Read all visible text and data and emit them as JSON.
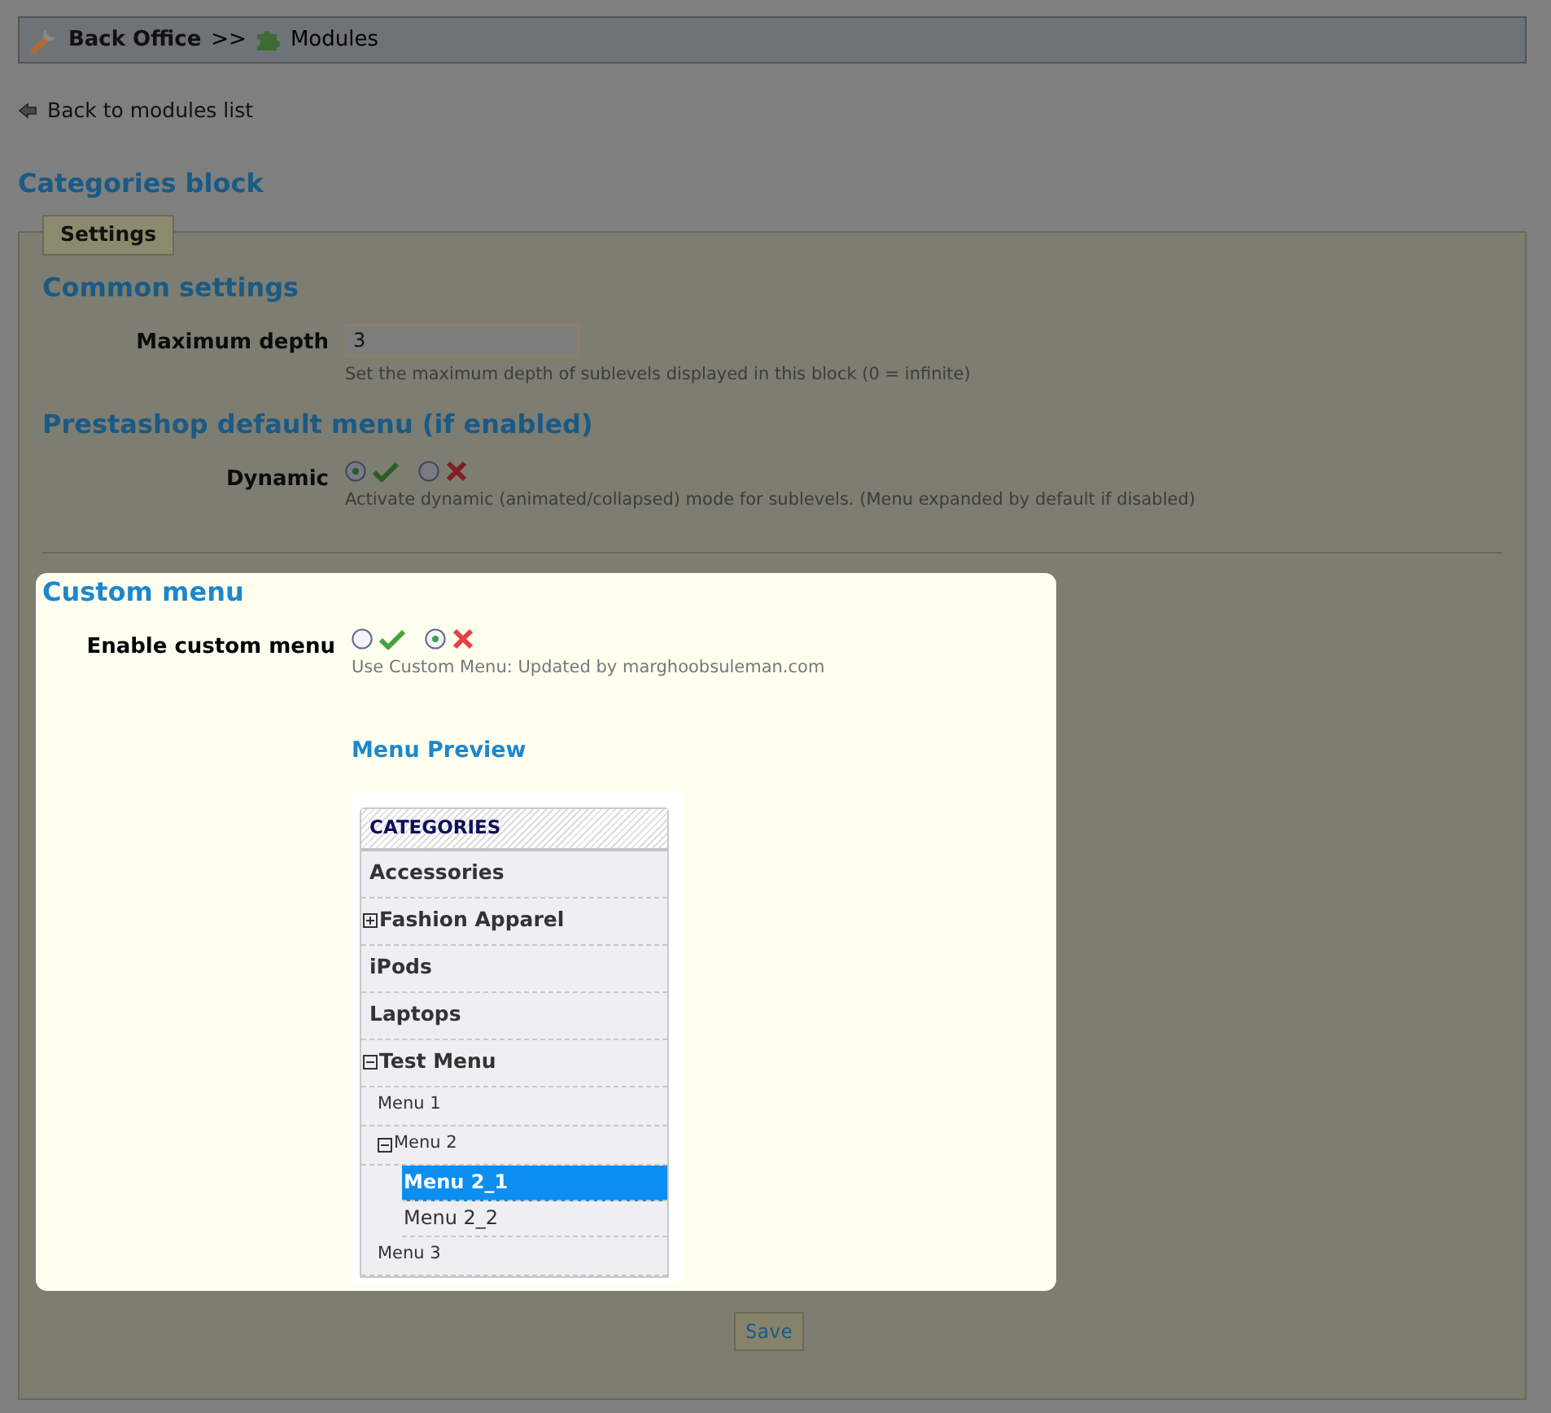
{
  "breadcrumb": {
    "root": "Back Office",
    "separator": ">>",
    "current": "Modules"
  },
  "back_link": "Back to modules list",
  "page_title": "Categories block",
  "tab": {
    "label": "Settings",
    "selected": true
  },
  "sections": [
    {
      "title": "Common settings",
      "dimmed": true,
      "fields": [
        {
          "kind": "text",
          "label": "Maximum depth",
          "value": "3",
          "help": "Set the maximum depth of sublevels displayed in this block (0 = infinite)"
        }
      ]
    },
    {
      "title": "Prestashop default menu (if enabled)",
      "dimmed": true,
      "fields": [
        {
          "kind": "yesno",
          "label": "Dynamic",
          "options": [
            {
              "kind": "yes",
              "selected": true
            },
            {
              "kind": "no",
              "selected": false
            }
          ],
          "help": "Activate dynamic (animated/collapsed) mode for sublevels. (Menu expanded by default if disabled)"
        }
      ]
    },
    {
      "title": "Custom menu",
      "dimmed": false,
      "fields": [
        {
          "kind": "yesno",
          "label": "Enable custom menu",
          "options": [
            {
              "kind": "yes",
              "selected": false
            },
            {
              "kind": "no",
              "selected": true
            }
          ],
          "help": "Use Custom Menu: Updated by marghoobsuleman.com"
        }
      ],
      "preview": {
        "title": "Menu Preview",
        "header": "CATEGORIES",
        "items": [
          {
            "label": "Accessories",
            "kind": "leaf",
            "selected": false
          },
          {
            "label": "Fashion Apparel",
            "kind": "folder",
            "expanded": false,
            "selected": false
          },
          {
            "label": "iPods",
            "kind": "leaf",
            "selected": false
          },
          {
            "label": "Laptops",
            "kind": "leaf",
            "selected": false
          },
          {
            "label": "Test Menu",
            "kind": "folder",
            "expanded": true,
            "selected": false,
            "children": [
              {
                "label": "Menu 1",
                "kind": "leaf",
                "selected": false
              },
              {
                "label": "Menu 2",
                "kind": "folder",
                "expanded": true,
                "selected": false,
                "children": [
                  {
                    "label": "Menu 2_1",
                    "kind": "leaf",
                    "selected": true
                  },
                  {
                    "label": "Menu 2_2",
                    "kind": "leaf",
                    "selected": false
                  }
                ]
              },
              {
                "label": "Menu 3",
                "kind": "leaf",
                "selected": false
              }
            ]
          }
        ]
      }
    }
  ],
  "save_button": "Save"
}
